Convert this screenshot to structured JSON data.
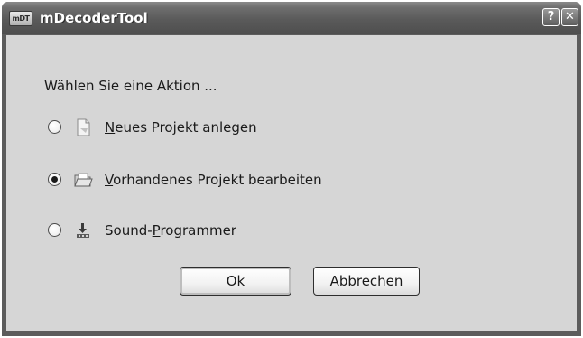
{
  "window": {
    "logo_text": "mDT",
    "title": "mDecoderTool",
    "help_glyph": "?",
    "close_glyph": "✕"
  },
  "dialog": {
    "prompt": "Wählen Sie eine Aktion ...",
    "options": [
      {
        "mnemonic": "N",
        "rest": "eues Projekt anlegen",
        "icon": "new-document-icon",
        "selected": false
      },
      {
        "mnemonic": "V",
        "rest": "orhandenes Projekt bearbeiten",
        "icon": "open-folder-icon",
        "selected": true
      },
      {
        "prefix": "Sound-",
        "mnemonic": "P",
        "rest": "rogrammer",
        "icon": "download-icon",
        "selected": false
      }
    ],
    "buttons": {
      "ok": "Ok",
      "cancel": "Abbrechen"
    }
  }
}
